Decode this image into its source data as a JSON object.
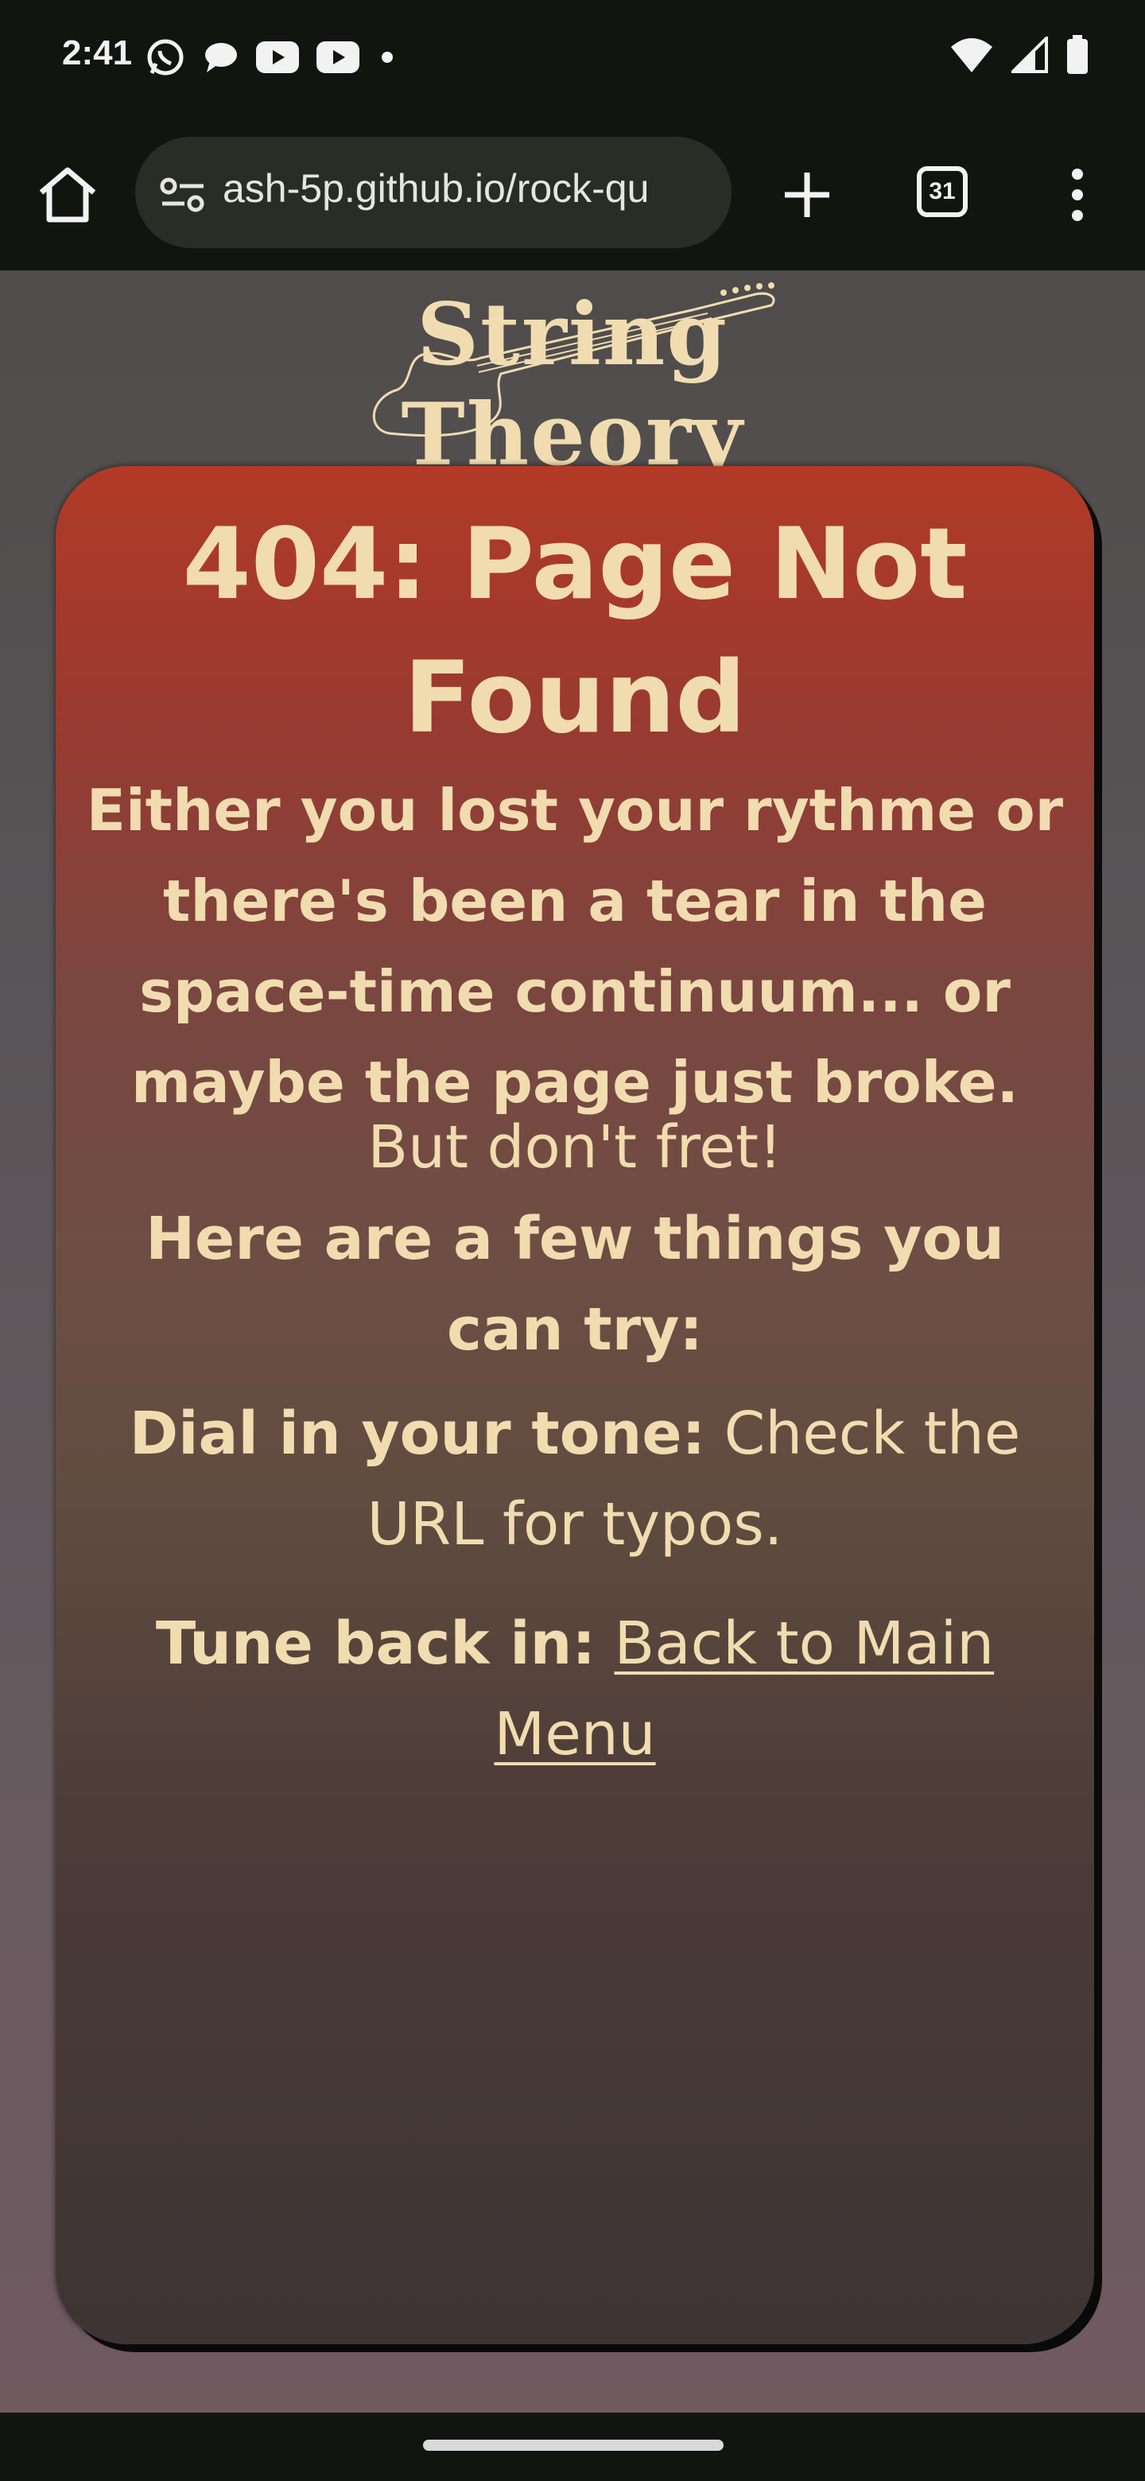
{
  "status_bar": {
    "time": "2:41",
    "notification_icons": [
      "whatsapp-icon",
      "chat-icon",
      "youtube-icon",
      "youtube-icon",
      "dot-icon"
    ],
    "system_icons": [
      "wifi-icon",
      "signal-icon",
      "battery-icon"
    ]
  },
  "browser": {
    "url": "ash-5p.github.io/rock-qu",
    "tab_count": "31"
  },
  "site": {
    "logo_text": "String Theory"
  },
  "error_card": {
    "title": "404: Page Not Found",
    "intro": "Either you lost your rythme or there's been a tear in the space-time continuum... or maybe the page just broke.",
    "reassure": "But don't fret!",
    "try_heading": "Here are a few things you can try:",
    "tip1_label": "Dial in your tone:",
    "tip1_text": "Check the URL for typos.",
    "tip2_label": "Tune back in:",
    "tip2_link": "Back to Main Menu"
  },
  "colors": {
    "card_top": "#b23a26",
    "card_bottom": "#3e3434",
    "text_cream": "#f1dcb0",
    "page_bg": "#5a5558"
  }
}
